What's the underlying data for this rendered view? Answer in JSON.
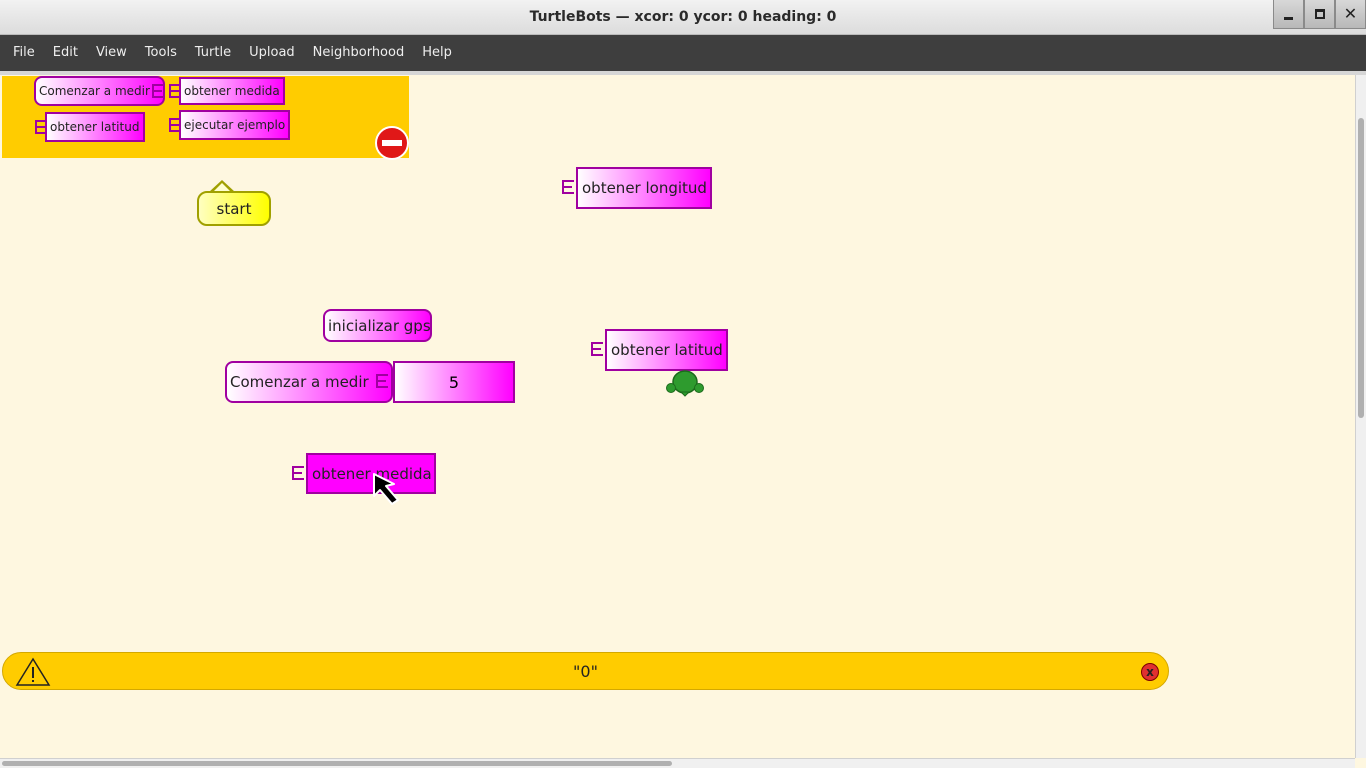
{
  "window": {
    "title": "TurtleBots — xcor: 0 ycor: 0 heading: 0"
  },
  "menu": {
    "items": [
      "File",
      "Edit",
      "View",
      "Tools",
      "Turtle",
      "Upload",
      "Neighborhood",
      "Help"
    ]
  },
  "palette": {
    "blocks": [
      "Comenzar a medir",
      "obtener medida",
      "obtener latitud",
      "ejecutar ejemplo"
    ]
  },
  "canvas": {
    "start_label": "start",
    "blocks": {
      "obtener_longitud": "obtener longitud",
      "inicializar_gps": "inicializar gps",
      "comenzar_a_medir": "Comenzar a medir",
      "number_value": "5",
      "obtener_latitud": "obtener latitud",
      "obtener_medida": "obtener medida"
    }
  },
  "status": {
    "message": "\"0\""
  },
  "colors": {
    "block_magenta": "#ff00ff",
    "palette_bg": "#ffcc00",
    "canvas_bg": "#fef7e0",
    "menubar_bg": "#3e3e3e",
    "start_yellow": "#ffff00"
  },
  "icons": [
    "minimize-icon",
    "maximize-icon",
    "close-icon",
    "trash-icon",
    "warning-icon",
    "status-close-icon",
    "turtle-icon",
    "pointer-cursor-icon"
  ]
}
